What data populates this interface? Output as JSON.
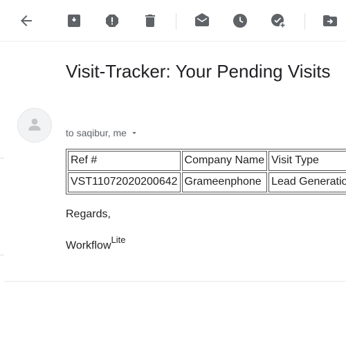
{
  "toolbar": {
    "buttons": [
      {
        "name": "back",
        "icon": "arrow-left-icon"
      },
      {
        "name": "archive",
        "icon": "archive-icon"
      },
      {
        "name": "report-spam",
        "icon": "report-spam-icon"
      },
      {
        "name": "delete",
        "icon": "trash-icon"
      },
      {
        "name": "mark-unread",
        "icon": "mail-open-icon"
      },
      {
        "name": "snooze",
        "icon": "clock-icon"
      },
      {
        "name": "add-to-tasks",
        "icon": "add-task-icon"
      },
      {
        "name": "move-to",
        "icon": "move-to-folder-icon"
      }
    ],
    "icon_color": "#5f6368"
  },
  "email": {
    "subject": "Visit-Tracker: Your Pending Visits",
    "recipients": "to saqibur, me",
    "table": {
      "headers": [
        "Ref #",
        "Company Name",
        "Visit Type"
      ],
      "rows": [
        [
          "VST11072020200642",
          "Grameenphone",
          "Lead Generation"
        ]
      ]
    },
    "regards": "Regards,",
    "signature_main": "Workflow",
    "signature_sup": "Lite"
  }
}
